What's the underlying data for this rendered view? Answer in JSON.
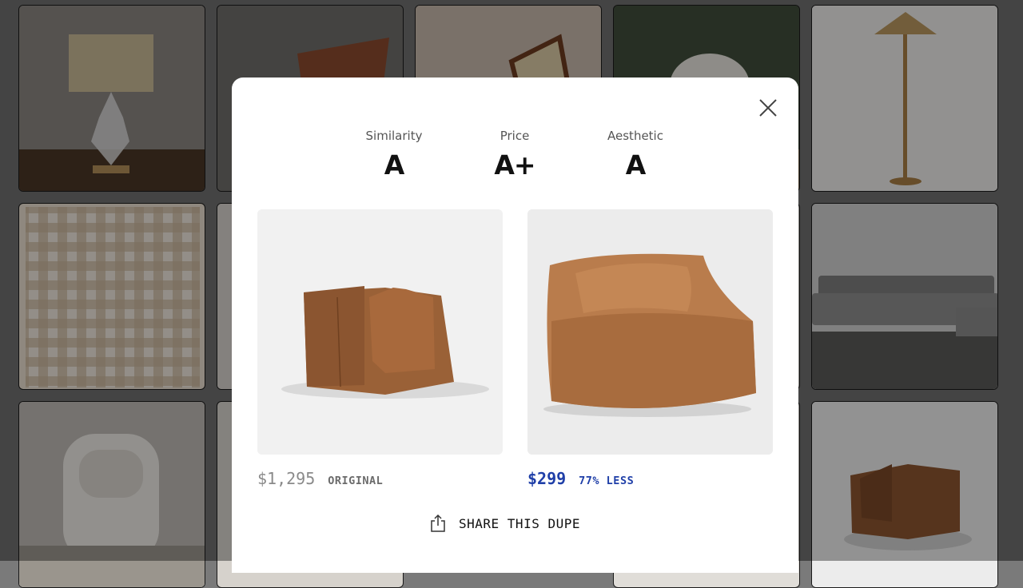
{
  "background_tiles": [
    {
      "name": "table-lamp-tile",
      "bg": "#8b8680"
    },
    {
      "name": "leather-chair-tile",
      "bg": "#6f6d69"
    },
    {
      "name": "cane-chair-tile",
      "bg": "#c9b9ad"
    },
    {
      "name": "outdoor-chair-tile",
      "bg": "#4d5a45"
    },
    {
      "name": "floor-lamp-tile",
      "bg": "#eeeeec"
    },
    {
      "name": "gingham-rug-tile",
      "bg": "#e7dccd"
    },
    {
      "name": "rug-2-tile",
      "bg": "#d8d4ce"
    },
    {
      "name": "sectional-sofa-tile",
      "bg": "#bdbdbd"
    },
    {
      "name": "white-chair-tile",
      "bg": "#cfccc8"
    },
    {
      "name": "leather-armchair-tile",
      "bg": "#f2f2f2"
    }
  ],
  "modal": {
    "grades": [
      {
        "label": "Similarity",
        "value": "A"
      },
      {
        "label": "Price",
        "value": "A+"
      },
      {
        "label": "Aesthetic",
        "value": "A"
      }
    ],
    "original": {
      "price": "$1,295",
      "tag": "ORIGINAL",
      "price_color": "#8a8a8a",
      "tag_color": "#6b6b6b"
    },
    "dupe": {
      "price": "$299",
      "tag": "77% LESS",
      "color": "#1f3fa8"
    },
    "share_label": "SHARE THIS DUPE"
  }
}
